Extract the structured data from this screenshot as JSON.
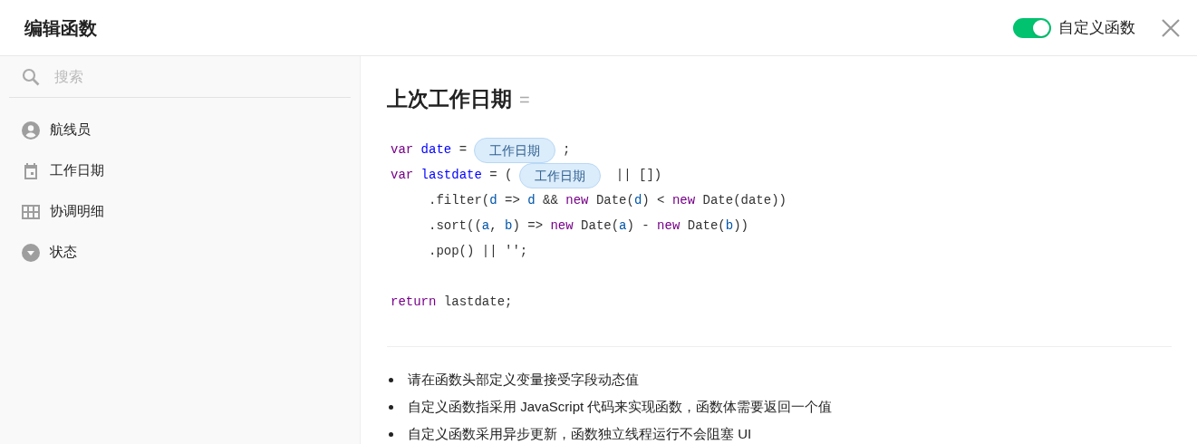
{
  "window": {
    "title": "编辑函数",
    "toggle": {
      "label": "自定义函数",
      "on": true
    }
  },
  "sidebar": {
    "search": {
      "placeholder": "搜索"
    },
    "items": [
      {
        "label": "航线员",
        "kind": "user"
      },
      {
        "label": "工作日期",
        "kind": "date"
      },
      {
        "label": "协调明细",
        "kind": "table"
      },
      {
        "label": "状态",
        "kind": "select"
      }
    ]
  },
  "editor": {
    "title": "上次工作日期",
    "title_suffix": "=",
    "code": [
      {
        "lines": [
          {
            "tokens": [
              {
                "kind": "keyword",
                "text": "var"
              },
              {
                "kind": "def",
                "text": " date"
              },
              {
                "kind": "plain",
                "text": " ="
              },
              {
                "kind": "field",
                "text": "工作日期"
              },
              {
                "kind": "plain",
                "text": ";"
              }
            ]
          },
          {
            "tokens": [
              {
                "kind": "keyword",
                "text": "var"
              },
              {
                "kind": "def",
                "text": " lastdate"
              },
              {
                "kind": "plain",
                "text": " = ("
              },
              {
                "kind": "field",
                "text": "工作日期"
              },
              {
                "kind": "plain",
                "text": " || [])"
              }
            ]
          },
          {
            "tokens": [
              {
                "kind": "plain",
                "text": "     .filter("
              },
              {
                "kind": "param",
                "text": "d"
              },
              {
                "kind": "plain",
                "text": " =>"
              },
              {
                "kind": "param",
                "text": " d"
              },
              {
                "kind": "plain",
                "text": " &&"
              },
              {
                "kind": "keyword",
                "text": " new"
              },
              {
                "kind": "plain",
                "text": " Date("
              },
              {
                "kind": "param",
                "text": "d"
              },
              {
                "kind": "plain",
                "text": ") <"
              },
              {
                "kind": "keyword",
                "text": " new"
              },
              {
                "kind": "plain",
                "text": " Date(date))"
              }
            ]
          },
          {
            "tokens": [
              {
                "kind": "plain",
                "text": "     .sort(("
              },
              {
                "kind": "param",
                "text": "a"
              },
              {
                "kind": "plain",
                "text": ","
              },
              {
                "kind": "param",
                "text": " b"
              },
              {
                "kind": "plain",
                "text": ") =>"
              },
              {
                "kind": "keyword",
                "text": " new"
              },
              {
                "kind": "plain",
                "text": " Date("
              },
              {
                "kind": "param",
                "text": "a"
              },
              {
                "kind": "plain",
                "text": ") -"
              },
              {
                "kind": "keyword",
                "text": " new"
              },
              {
                "kind": "plain",
                "text": " Date("
              },
              {
                "kind": "param",
                "text": "b"
              },
              {
                "kind": "plain",
                "text": "))"
              }
            ]
          },
          {
            "tokens": [
              {
                "kind": "plain",
                "text": "     .pop() || '';"
              }
            ]
          }
        ]
      },
      {
        "lines": [
          {
            "tokens": [
              {
                "kind": "keyword",
                "text": "return"
              },
              {
                "kind": "plain",
                "text": " lastdate;"
              }
            ]
          }
        ]
      }
    ],
    "notes": [
      "请在函数头部定义变量接受字段动态值",
      "自定义函数指采用 JavaScript 代码来实现函数，函数体需要返回一个值",
      "自定义函数采用异步更新，函数独立线程运行不会阻塞 UI"
    ]
  }
}
